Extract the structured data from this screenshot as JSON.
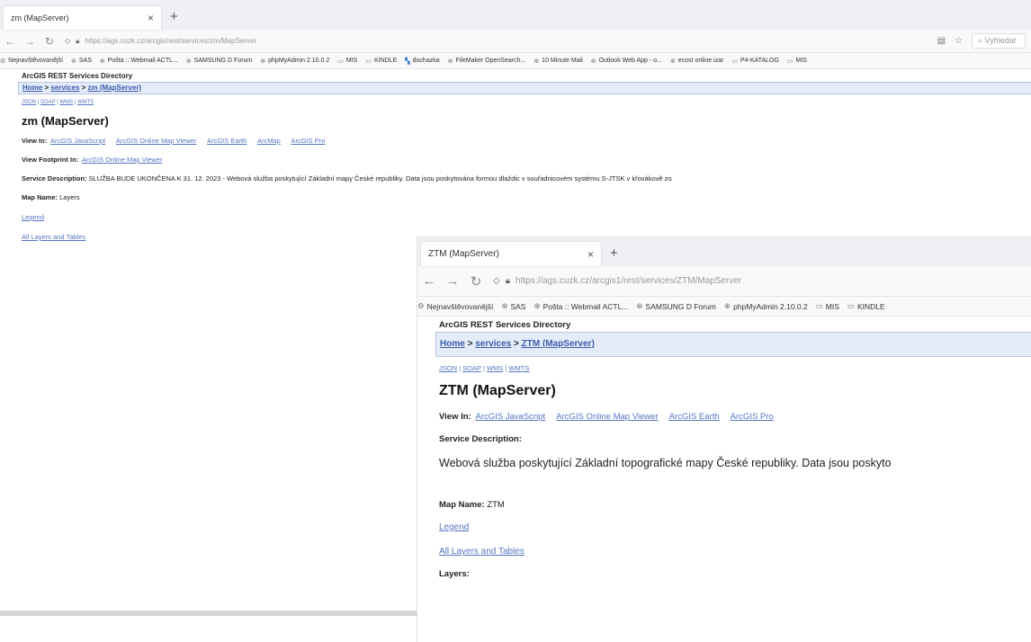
{
  "win1": {
    "tab_title": "zm (MapServer)",
    "tab_close": "×",
    "new_tab": "+",
    "url": "https://ags.cuzk.cz/arcgis/rest/services/zm/MapServer",
    "search_placeholder": "Vyhledat",
    "bookmarks": [
      "Nejnavštěvovanější",
      "SAS",
      "Pošta :: Webmail ACTL...",
      "SAMSUNG D Forum",
      "phpMyAdmin 2.10.0.2",
      "MIS",
      "KINDLE",
      "dochazka",
      "FileMaker OpenSearch...",
      "10 Minute Mail",
      "Outlook Web App - o...",
      "ecost online izar",
      "P4-KATALOG",
      "MIS"
    ],
    "dir_title": "ArcGIS REST Services Directory",
    "breadcrumb": {
      "home": "Home",
      "sep1": " > ",
      "services": "services",
      "sep2": " > ",
      "current": "zm (MapServer)"
    },
    "formats": {
      "json": "JSON",
      "soap": "SOAP",
      "wms": "WMS",
      "wmts": "WMTS",
      "sep": " | "
    },
    "page_title": "zm (MapServer)",
    "view_in_label": "View In:",
    "view_in_links": [
      "ArcGIS JavaScript",
      "ArcGIS Online Map Viewer",
      "ArcGIS Earth",
      "ArcMap",
      "ArcGIS Pro"
    ],
    "footprint_label": "View Footprint In:",
    "footprint_link": "ArcGIS Online Map Viewer",
    "desc_label": "Service Description:",
    "desc_text": "SLUŽBA BUDE UKONČENA K 31. 12. 2023 - Webová služba poskytující Základní mapy České republiky. Data jsou poskytována formou dlaždic v souřadnicovém systému S-JTSK v křovákově zo",
    "map_name_label": "Map Name:",
    "map_name": "Layers",
    "legend": "Legend",
    "all_layers": "All Layers and Tables"
  },
  "win2": {
    "tab_title": "ZTM (MapServer)",
    "tab_close": "×",
    "new_tab": "+",
    "url": "https://ags.cuzk.cz/arcgis1/rest/services/ZTM/MapServer",
    "bookmarks": [
      "Nejnavštěvovanější",
      "SAS",
      "Pošta :: Webmail ACTL...",
      "SAMSUNG D Forum",
      "phpMyAdmin 2.10.0.2",
      "MIS",
      "KINDLE"
    ],
    "dir_title": "ArcGIS REST Services Directory",
    "breadcrumb": {
      "home": "Home",
      "sep1": " > ",
      "services": "services",
      "sep2": " > ",
      "current": "ZTM (MapServer)"
    },
    "formats": {
      "json": "JSON",
      "soap": "SOAP",
      "wms": "WMS",
      "wmts": "WMTS",
      "sep": " | "
    },
    "page_title": "ZTM (MapServer)",
    "view_in_label": "View In:",
    "view_in_links": [
      "ArcGIS JavaScript",
      "ArcGIS Online Map Viewer",
      "ArcGIS Earth",
      "ArcGIS Pro"
    ],
    "desc_label": "Service Description:",
    "desc_text": "Webová služba poskytující Základní topografické mapy České republiky. Data jsou poskyto",
    "map_name_label": "Map Name:",
    "map_name": "ZTM",
    "legend": "Legend",
    "all_layers": "All Layers and Tables",
    "layers_label": "Layers:"
  }
}
